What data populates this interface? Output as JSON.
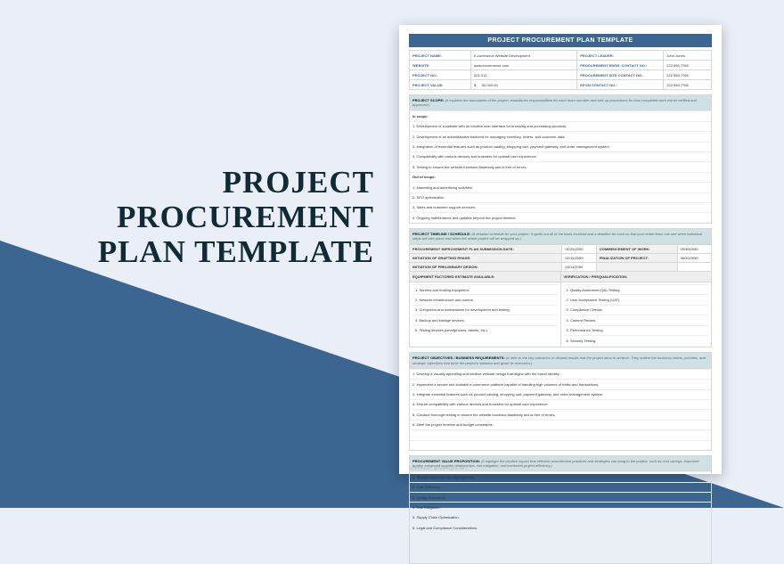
{
  "banner_title": "PROJECT\nPROCUREMENT\nPLAN TEMPLATE",
  "doc_header": "PROJECT PROCUREMENT PLAN TEMPLATE",
  "info": {
    "project_name_l": "PROJECT NAME:",
    "project_name": "E-commerce Website Development",
    "project_leader_l": "PROJECT LEADER:",
    "project_leader": "John Jones",
    "website_l": "WEBSITE:",
    "website": "www.ecommerce.com",
    "engr_l": "PROCUREMENT ENGR. CONTACT NO.:",
    "engr": "222 555 7766",
    "projno_l": "PROJECT NO.:",
    "projno": "001-011",
    "site_l": "PROCUREMENT SITE CONTACT NO.:",
    "site": "222 555 7766",
    "value_l": "PROJECT VALUE:",
    "value_cur": "$",
    "value": "50,000.00",
    "epcm_l": "EPCM CONTACT NO.:",
    "epcm": "222 555 7766"
  },
  "sec_scope": {
    "title": "PROJECT SCOPE:",
    "sub": "(It explains the boundaries of the project, establishes responsibilities for each team member and sets up procedures for how completed work will be verified and approved.)",
    "in_scope_l": "In scope:",
    "in_scope": [
      "1. Development of a website with an intuitive user interface for browsing and purchasing products.",
      "2. Development of an administrative backend for managing inventory, orders, and customer data.",
      "3. Integration of essential features such as product catalog, shopping cart, payment gateway, and order management system.",
      "4. Compatibility with various devices and browsers for optimal user experience.",
      "5. Testing to ensure the website functions flawlessly and is free of errors."
    ],
    "out_scope_l": "Out of scope:",
    "out_scope": [
      "1. Marketing and advertising activities.",
      "2. SEO optimization.",
      "3. Sales and customer support services.",
      "4. Ongoing maintenance and updates beyond the project timeline."
    ]
  },
  "sec_timeline": {
    "title": "PROJECT TIMELINE / SCHEDULE:",
    "sub": "(A detailed schedule for your project. It spells out all of the tasks involved and a deadline for each so that your entire team can see when individual steps will take place and when the whole project will be wrapped up.)",
    "rows": [
      [
        "PROCUREMENT IMPROVEMENT PLAN SUBMISSION DATE:",
        "01/25/2050",
        "COMMENCEMENT OF WORK:",
        "05/30/2050"
      ],
      [
        "INITIATION OF DRAFTING PHASE:",
        "02/15/2050",
        "FINALIZATION OF PROJECT:",
        "06/10/2050"
      ],
      [
        "INITIATION OF PRELIMINARY DESIGN:",
        "04/11/2050",
        "",
        ""
      ]
    ],
    "equip_l": "EQUIPMENT FACTORED ESTIMATE AVAILABLE:",
    "verif_l": "VERIFICATION / PREQUALIFICATION:",
    "equip": [
      "1. Servers and hosting equipment.",
      "2. Network infrastructure and routers.",
      "3. Computers and workstations for development and testing.",
      "4. Backup and storage devices.",
      "5. Testing devices (smartphones, tablets, etc.)."
    ],
    "verif": [
      "1. Quality Assurance (QA) Testing.",
      "2. User Acceptance Testing (UAT).",
      "3. Compliance Checks.",
      "4. Content Review.",
      "5. Performance Testing.",
      "6. Security Testing."
    ]
  },
  "sec_obj": {
    "title": "PROJECT OBJECTIVES / BUSINESS REQUIREMENTS:",
    "sub": "(It refer to the key outcomes or desired results that the project aims to achieve. They outline the business needs, priorities, and strategic objectives that drive the project's initiation and guide its execution.)",
    "items": [
      "1. Develop a visually appealing and intuitive website design that aligns with the brand identity.",
      "2. Implement a secure and scalable e-commerce platform capable of handling high volumes of traffic and transactions.",
      "3. Integrate essential features such as product catalog, shopping cart, payment gateway, and order management system.",
      "4. Ensure compatibility with various devices and browsers for optimal user experience.",
      "5. Conduct thorough testing to ensure the website functions flawlessly and is free of errors.",
      "6. Meet the project timeline and budget constraints."
    ]
  },
  "sec_val": {
    "title": "PROCUREMENT VALUE PROPOSITION:",
    "sub": "(It highlight the positive impact that effective procurement practices and strategies can bring to the project, such as cost savings, improved quality, enhanced supplier relationships, risk mitigation, and increased project efficiency.)",
    "items": [
      "1. Supplier Selection and Management.",
      "2. Cost Efficiency.",
      "3. Quality Assurance.",
      "4. Risk Mitigation.",
      "5. Supply Chain Optimization.",
      "6. Legal and Compliance Considerations."
    ]
  },
  "copyright": "COPYRIGHT @TEMPLATE.NET"
}
